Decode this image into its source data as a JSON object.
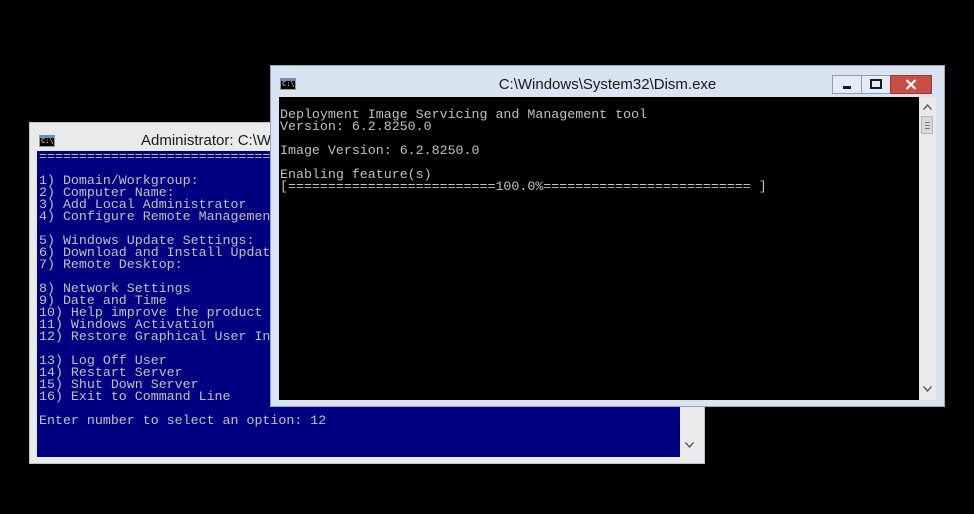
{
  "back_window": {
    "icon_text": "C:\\.",
    "title": "Administrator: C:\\W",
    "console_lines": [
      "===============================================================================",
      "",
      "1) Domain/Workgroup:",
      "2) Computer Name:",
      "3) Add Local Administrator",
      "4) Configure Remote Managemen",
      "",
      "5) Windows Update Settings:",
      "6) Download and Install Updat",
      "7) Remote Desktop:",
      "",
      "8) Network Settings",
      "9) Date and Time",
      "10) Help improve the product",
      "11) Windows Activation",
      "12) Restore Graphical User In",
      "",
      "13) Log Off User",
      "14) Restart Server",
      "15) Shut Down Server",
      "16) Exit to Command Line",
      "",
      "Enter number to select an option: 12"
    ]
  },
  "front_window": {
    "icon_text": "C:\\.",
    "title": "C:\\Windows\\System32\\Dism.exe",
    "console_lines": [
      "Deployment Image Servicing and Management tool",
      "Version: 6.2.8250.0",
      "",
      "Image Version: 6.2.8250.0",
      "",
      "Enabling feature(s)",
      "[==========================100.0%========================== ]"
    ],
    "progress_percent": 100.0
  },
  "colors": {
    "desktop_bg": "#000000",
    "sconfig_console_bg": "#000080",
    "dism_console_bg": "#000000",
    "console_text": "#c0c0c0",
    "close_button": "#c74f48"
  }
}
